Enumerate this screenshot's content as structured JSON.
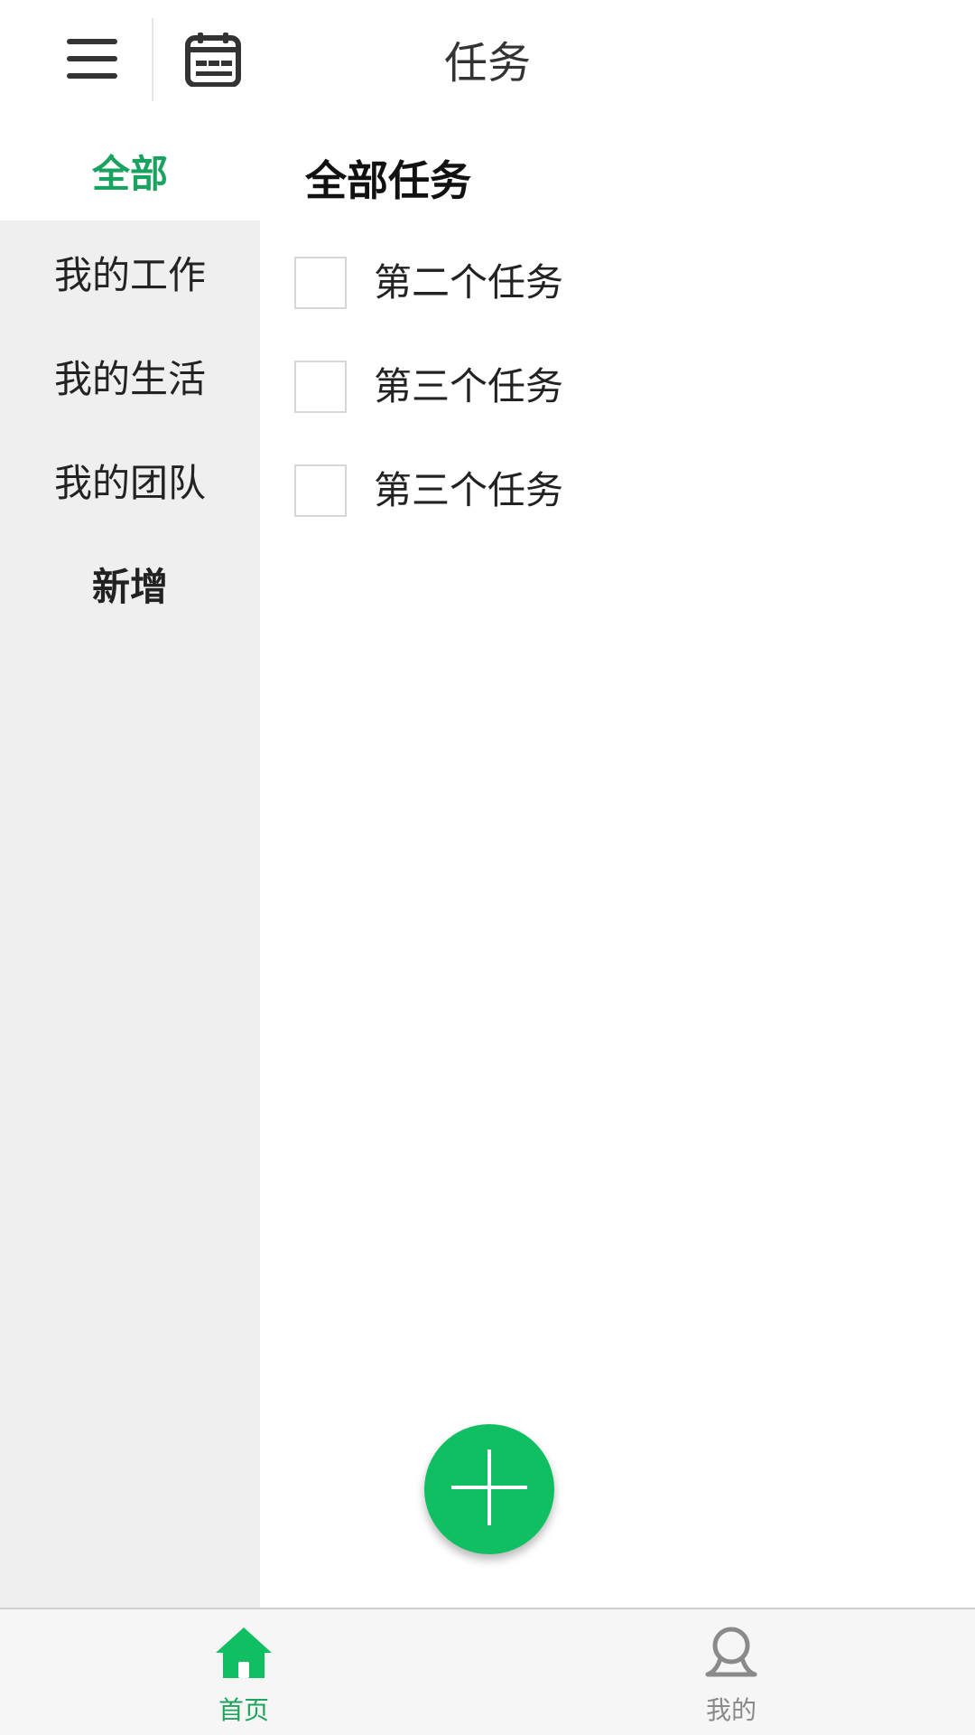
{
  "header": {
    "title": "任务",
    "menu_icon": "hamburger-menu-icon",
    "calendar_icon": "calendar-icon"
  },
  "sidebar": {
    "items": [
      {
        "label": "全部"
      },
      {
        "label": "我的工作"
      },
      {
        "label": "我的生活"
      },
      {
        "label": "我的团队"
      },
      {
        "label": "新增"
      }
    ]
  },
  "main": {
    "section_title": "全部任务",
    "tasks": [
      {
        "label": "第二个任务",
        "checked": false
      },
      {
        "label": "第三个任务",
        "checked": false
      },
      {
        "label": "第三个任务",
        "checked": false
      }
    ]
  },
  "fab": {
    "icon": "plus-icon"
  },
  "tabbar": {
    "home_label": "首页",
    "mine_label": "我的",
    "home_icon": "home-icon",
    "mine_icon": "person-icon"
  },
  "colors": {
    "accent": "#10bf62",
    "sidebar_bg": "#efefef",
    "active_text": "#1aa35f"
  }
}
